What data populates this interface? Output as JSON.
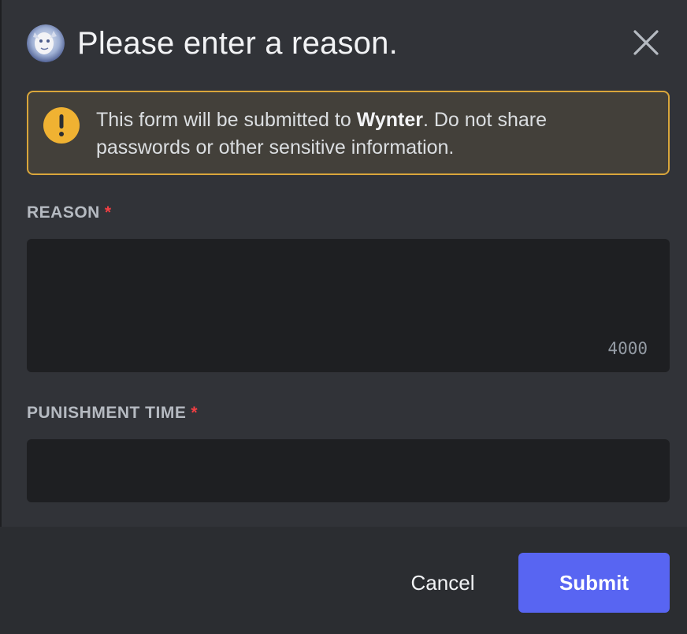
{
  "modal": {
    "title": "Please enter a reason.",
    "avatar_icon": "bot-avatar-icon",
    "close_icon": "close-icon"
  },
  "notice": {
    "icon": "warning-icon",
    "text_before": "This form will be submitted to ",
    "app_name": "Wynter",
    "text_after": ". Do not share passwords or other sensitive information.",
    "border_color": "#d9a63b"
  },
  "fields": {
    "reason": {
      "label": "REASON",
      "required_marker": "*",
      "value": "",
      "char_count": "4000"
    },
    "punishment_time": {
      "label": "PUNISHMENT TIME",
      "required_marker": "*",
      "value": ""
    }
  },
  "footer": {
    "cancel_label": "Cancel",
    "submit_label": "Submit",
    "submit_color": "#5865f2"
  }
}
